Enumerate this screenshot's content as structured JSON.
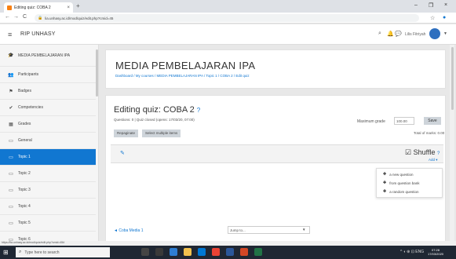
{
  "browser": {
    "tab_title": "Editing quiz: COBA 2",
    "tab_close": "×",
    "new_tab": "+",
    "window_controls": {
      "minimize": "–",
      "maximize": "❐",
      "close": "×"
    },
    "url": "lia.unhasy.ac.id/mod/quiz/edit.php?cmid=45",
    "nav": {
      "back": "←",
      "forward": "→",
      "reload": "C"
    }
  },
  "moodle_nav": {
    "site_name": "RIP UNHASY",
    "user_name": "Lilis Fitriyah",
    "hamburger": "≡"
  },
  "sidebar": {
    "items": [
      {
        "label": "MEDIA PEMBELAJARAN IPA",
        "icon": "graduation-cap-icon",
        "glyph": "🎓",
        "active": false
      },
      {
        "label": "Participants",
        "icon": "users-icon",
        "glyph": "👥",
        "active": false
      },
      {
        "label": "Badges",
        "icon": "badge-icon",
        "glyph": "⚑",
        "active": false
      },
      {
        "label": "Competencies",
        "icon": "check-icon",
        "glyph": "✔",
        "active": false
      },
      {
        "label": "Grades",
        "icon": "table-icon",
        "glyph": "▦",
        "active": false
      },
      {
        "label": "General",
        "icon": "folder-icon",
        "glyph": "▭",
        "active": false
      },
      {
        "label": "Topic 1",
        "icon": "folder-icon",
        "glyph": "▭",
        "active": true
      },
      {
        "label": "Topic 2",
        "icon": "folder-icon",
        "glyph": "▭",
        "active": false
      },
      {
        "label": "Topic 3",
        "icon": "folder-icon",
        "glyph": "▭",
        "active": false
      },
      {
        "label": "Topic 4",
        "icon": "folder-icon",
        "glyph": "▭",
        "active": false
      },
      {
        "label": "Topic 5",
        "icon": "folder-icon",
        "glyph": "▭",
        "active": false
      },
      {
        "label": "Topic 6",
        "icon": "folder-icon",
        "glyph": "▭",
        "active": false
      }
    ]
  },
  "header": {
    "course_title": "MEDIA PEMBELAJARAN IPA",
    "breadcrumb": "Dashboard / My courses / MEDIA PEMBELAJARAN IPA / Topic 1 / COBA 2 / Edit quiz"
  },
  "quiz": {
    "title": "Editing quiz: COBA 2",
    "help_glyph": "?",
    "meta": "Questions: 0 | Quiz closed (opens: 17/03/20, 07:00)",
    "max_grade_label": "Maximum grade",
    "max_grade_value": "100.00",
    "save_label": "Save",
    "repaginate_label": "Repaginate",
    "select_multiple_label": "Select multiple items",
    "total_marks": "Total of marks: 0.00",
    "shuffle_label": "Shuffle",
    "add_label": "Add ▾",
    "add_menu": [
      {
        "label": "a new question"
      },
      {
        "label": "from question bank"
      },
      {
        "label": "a random question"
      }
    ],
    "prev_link": "◄ Coba Media 1",
    "jump_to": "Jump to...",
    "jump_caret": "▼"
  },
  "status_url": "https://lia.unhasy.ac.id/mod/quiz/edit.php?cmid=45#",
  "taskbar": {
    "search_placeholder": "Type here to search",
    "clock_time": "07:28",
    "clock_date": "17/03/2020",
    "tray": "^ ◖ ⊕ ⊡ ENG"
  }
}
